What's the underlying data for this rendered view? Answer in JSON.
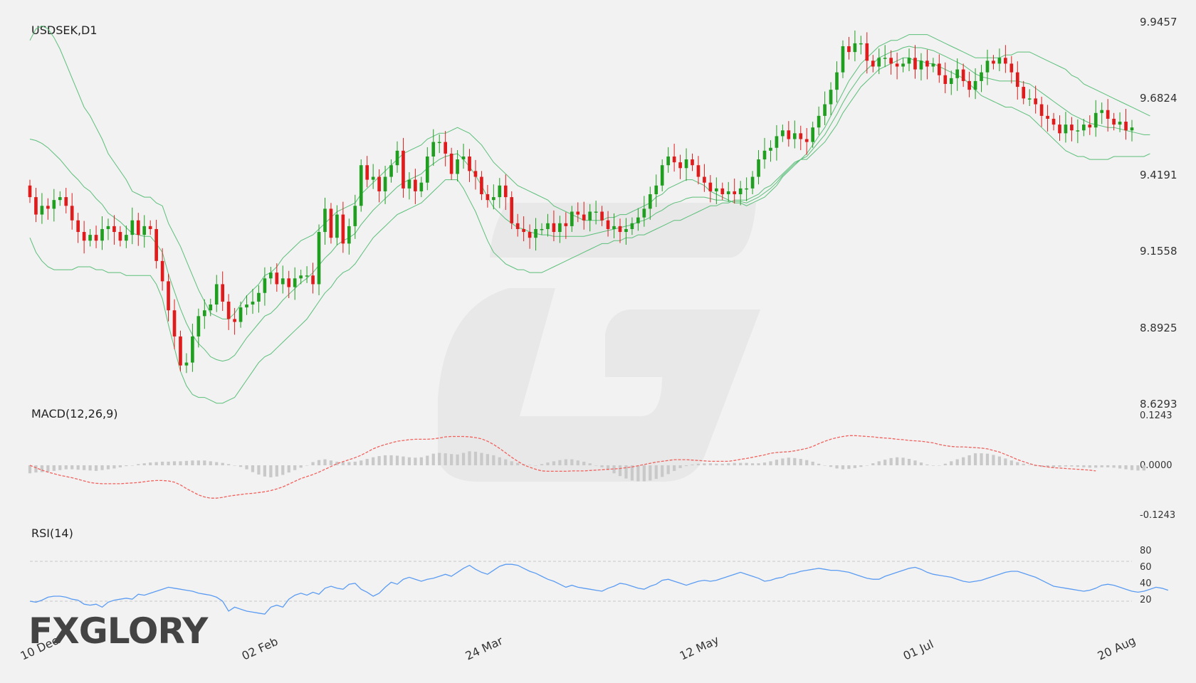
{
  "brand": {
    "logo_text": "FXGLORY",
    "accent": "#f07e26",
    "logo_color": "#444444"
  },
  "chart_data": [
    {
      "type": "candlestick",
      "title": "USDSEK,D1",
      "y_ticks": [
        "9.9457",
        "9.6824",
        "9.4191",
        "9.1558",
        "8.8925",
        "8.6293"
      ],
      "ylim": [
        8.6293,
        9.9457
      ],
      "x_labels": [
        "10 Dec",
        "02 Feb",
        "24 Mar",
        "12 May",
        "01 Jul",
        "20 Aug"
      ],
      "x_label_index": [
        0,
        38,
        79,
        117,
        157,
        195
      ],
      "up_color": "#1f9e1f",
      "down_color": "#e01b1b",
      "bands_color": "#5cbf7a",
      "close": [
        9.34,
        9.28,
        9.31,
        9.3,
        9.33,
        9.34,
        9.31,
        9.26,
        9.22,
        9.19,
        9.21,
        9.19,
        9.23,
        9.24,
        9.22,
        9.19,
        9.21,
        9.26,
        9.21,
        9.24,
        9.23,
        9.12,
        9.05,
        8.95,
        8.86,
        8.76,
        8.77,
        8.86,
        8.93,
        8.95,
        8.97,
        9.04,
        8.98,
        8.92,
        8.91,
        8.96,
        8.97,
        8.98,
        9.01,
        9.06,
        9.08,
        9.04,
        9.06,
        9.03,
        9.06,
        9.07,
        9.07,
        9.04,
        9.22,
        9.3,
        9.2,
        9.28,
        9.18,
        9.24,
        9.31,
        9.45,
        9.4,
        9.41,
        9.36,
        9.41,
        9.45,
        9.5,
        9.37,
        9.4,
        9.36,
        9.39,
        9.48,
        9.53,
        9.53,
        9.49,
        9.42,
        9.47,
        9.48,
        9.43,
        9.41,
        9.35,
        9.33,
        9.34,
        9.38,
        9.34,
        9.25,
        9.23,
        9.22,
        9.2,
        9.23,
        9.23,
        9.25,
        9.22,
        9.25,
        9.24,
        9.29,
        9.28,
        9.26,
        9.29,
        9.29,
        9.26,
        9.23,
        9.24,
        9.22,
        9.23,
        9.25,
        9.27,
        9.3,
        9.35,
        9.38,
        9.45,
        9.48,
        9.46,
        9.44,
        9.47,
        9.45,
        9.41,
        9.39,
        9.36,
        9.37,
        9.35,
        9.36,
        9.35,
        9.37,
        9.37,
        9.41,
        9.47,
        9.5,
        9.51,
        9.55,
        9.57,
        9.54,
        9.56,
        9.54,
        9.53,
        9.58,
        9.62,
        9.66,
        9.71,
        9.77,
        9.86,
        9.84,
        9.87,
        9.87,
        9.81,
        9.79,
        9.82,
        9.82,
        9.8,
        9.79,
        9.8,
        9.82,
        9.78,
        9.81,
        9.79,
        9.8,
        9.76,
        9.73,
        9.75,
        9.78,
        9.74,
        9.71,
        9.74,
        9.77,
        9.81,
        9.8,
        9.82,
        9.8,
        9.77,
        9.72,
        9.68,
        9.68,
        9.66,
        9.62,
        9.61,
        9.59,
        9.56,
        9.59,
        9.57,
        9.57,
        9.59,
        9.58,
        9.63,
        9.64,
        9.61,
        9.59,
        9.6,
        9.57,
        9.58
      ],
      "bb_upper": [
        9.88,
        9.92,
        9.93,
        9.92,
        9.89,
        9.85,
        9.8,
        9.75,
        9.7,
        9.65,
        9.62,
        9.58,
        9.54,
        9.49,
        9.46,
        9.43,
        9.4,
        9.36,
        9.35,
        9.34,
        9.34,
        9.32,
        9.31,
        9.25,
        9.21,
        9.17,
        9.12,
        9.07,
        9.02,
        8.98,
        8.94,
        8.93,
        8.92,
        8.92,
        8.94,
        8.97,
        9.0,
        9.02,
        9.04,
        9.07,
        9.08,
        9.1,
        9.13,
        9.15,
        9.17,
        9.19,
        9.2,
        9.21,
        9.23,
        9.25,
        9.27,
        9.29,
        9.3,
        9.31,
        9.32,
        9.35,
        9.37,
        9.39,
        9.41,
        9.43,
        9.45,
        9.47,
        9.49,
        9.5,
        9.51,
        9.52,
        9.54,
        9.55,
        9.56,
        9.56,
        9.57,
        9.58,
        9.57,
        9.56,
        9.54,
        9.52,
        9.49,
        9.46,
        9.44,
        9.42,
        9.4,
        9.38,
        9.37,
        9.36,
        9.35,
        9.34,
        9.33,
        9.31,
        9.3,
        9.29,
        9.28,
        9.27,
        9.26,
        9.26,
        9.26,
        9.26,
        9.27,
        9.27,
        9.28,
        9.28,
        9.29,
        9.3,
        9.31,
        9.32,
        9.34,
        9.35,
        9.37,
        9.38,
        9.39,
        9.4,
        9.4,
        9.39,
        9.38,
        9.36,
        9.35,
        9.34,
        9.33,
        9.32,
        9.32,
        9.31,
        9.32,
        9.33,
        9.34,
        9.36,
        9.38,
        9.41,
        9.43,
        9.45,
        9.47,
        9.49,
        9.52,
        9.55,
        9.58,
        9.62,
        9.66,
        9.7,
        9.74,
        9.77,
        9.8,
        9.82,
        9.84,
        9.86,
        9.87,
        9.88,
        9.88,
        9.89,
        9.9,
        9.9,
        9.9,
        9.9,
        9.89,
        9.88,
        9.87,
        9.86,
        9.85,
        9.84,
        9.83,
        9.82,
        9.82,
        9.82,
        9.82,
        9.82,
        9.83,
        9.83,
        9.84,
        9.84,
        9.84,
        9.83,
        9.82,
        9.81,
        9.8,
        9.79,
        9.78,
        9.76,
        9.75,
        9.73,
        9.72,
        9.71,
        9.7,
        9.69,
        9.68,
        9.67,
        9.66,
        9.65,
        9.64,
        9.63,
        9.62
      ],
      "bb_lower": [
        9.2,
        9.15,
        9.12,
        9.1,
        9.09,
        9.09,
        9.09,
        9.09,
        9.1,
        9.1,
        9.1,
        9.09,
        9.09,
        9.08,
        9.08,
        9.08,
        9.07,
        9.07,
        9.07,
        9.07,
        9.07,
        9.04,
        8.99,
        8.9,
        8.82,
        8.74,
        8.69,
        8.66,
        8.65,
        8.65,
        8.64,
        8.63,
        8.63,
        8.64,
        8.65,
        8.68,
        8.71,
        8.74,
        8.77,
        8.79,
        8.8,
        8.82,
        8.84,
        8.86,
        8.88,
        8.9,
        8.92,
        8.95,
        8.98,
        9.01,
        9.03,
        9.06,
        9.08,
        9.09,
        9.11,
        9.14,
        9.17,
        9.2,
        9.22,
        9.24,
        9.26,
        9.28,
        9.29,
        9.3,
        9.31,
        9.32,
        9.34,
        9.36,
        9.38,
        9.4,
        9.4,
        9.4,
        9.37,
        9.33,
        9.29,
        9.24,
        9.19,
        9.15,
        9.13,
        9.11,
        9.1,
        9.09,
        9.09,
        9.08,
        9.08,
        9.08,
        9.09,
        9.1,
        9.11,
        9.12,
        9.13,
        9.14,
        9.15,
        9.16,
        9.17,
        9.18,
        9.18,
        9.19,
        9.19,
        9.2,
        9.2,
        9.21,
        9.21,
        9.22,
        9.23,
        9.24,
        9.25,
        9.26,
        9.26,
        9.27,
        9.28,
        9.29,
        9.3,
        9.31,
        9.31,
        9.32,
        9.32,
        9.33,
        9.33,
        9.33,
        9.34,
        9.35,
        9.37,
        9.38,
        9.4,
        9.42,
        9.44,
        9.46,
        9.47,
        9.47,
        9.49,
        9.51,
        9.53,
        9.56,
        9.59,
        9.63,
        9.66,
        9.69,
        9.72,
        9.74,
        9.76,
        9.78,
        9.79,
        9.8,
        9.81,
        9.82,
        9.82,
        9.81,
        9.81,
        9.8,
        9.8,
        9.79,
        9.78,
        9.77,
        9.76,
        9.75,
        9.73,
        9.71,
        9.69,
        9.68,
        9.67,
        9.66,
        9.65,
        9.65,
        9.64,
        9.63,
        9.62,
        9.6,
        9.58,
        9.56,
        9.54,
        9.52,
        9.5,
        9.49,
        9.48,
        9.48,
        9.47,
        9.47,
        9.47,
        9.47,
        9.48,
        9.48,
        9.48,
        9.48,
        9.48,
        9.48,
        9.49
      ]
    },
    {
      "type": "macd",
      "title": "MACD(12,26,9)",
      "y_ticks": [
        "0.1243",
        "0.0000",
        "-0.1243"
      ],
      "ylim": [
        -0.1243,
        0.1243
      ],
      "signal_color": "#f0625d",
      "histogram_color": "#c9c9c9",
      "signal": [
        0.0,
        -0.006,
        -0.012,
        -0.017,
        -0.021,
        -0.025,
        -0.028,
        -0.031,
        -0.035,
        -0.039,
        -0.043,
        -0.045,
        -0.046,
        -0.046,
        -0.046,
        -0.046,
        -0.045,
        -0.044,
        -0.043,
        -0.041,
        -0.039,
        -0.038,
        -0.038,
        -0.039,
        -0.042,
        -0.049,
        -0.058,
        -0.066,
        -0.074,
        -0.079,
        -0.082,
        -0.082,
        -0.08,
        -0.077,
        -0.075,
        -0.073,
        -0.071,
        -0.07,
        -0.068,
        -0.066,
        -0.063,
        -0.059,
        -0.054,
        -0.047,
        -0.04,
        -0.033,
        -0.028,
        -0.023,
        -0.017,
        -0.01,
        -0.003,
        0.004,
        0.009,
        0.014,
        0.019,
        0.025,
        0.033,
        0.041,
        0.047,
        0.052,
        0.056,
        0.06,
        0.062,
        0.064,
        0.065,
        0.065,
        0.065,
        0.066,
        0.068,
        0.071,
        0.072,
        0.072,
        0.072,
        0.071,
        0.069,
        0.066,
        0.06,
        0.052,
        0.042,
        0.031,
        0.02,
        0.01,
        0.001,
        -0.005,
        -0.01,
        -0.014,
        -0.015,
        -0.015,
        -0.015,
        -0.015,
        -0.014,
        -0.014,
        -0.014,
        -0.013,
        -0.012,
        -0.011,
        -0.01,
        -0.009,
        -0.008,
        -0.006,
        -0.004,
        -0.001,
        0.002,
        0.005,
        0.008,
        0.01,
        0.012,
        0.014,
        0.014,
        0.014,
        0.013,
        0.012,
        0.011,
        0.01,
        0.01,
        0.01,
        0.01,
        0.012,
        0.015,
        0.017,
        0.02,
        0.023,
        0.026,
        0.03,
        0.032,
        0.033,
        0.034,
        0.036,
        0.039,
        0.042,
        0.047,
        0.054,
        0.06,
        0.065,
        0.069,
        0.072,
        0.074,
        0.074,
        0.073,
        0.072,
        0.071,
        0.069,
        0.068,
        0.067,
        0.065,
        0.064,
        0.062,
        0.061,
        0.06,
        0.058,
        0.056,
        0.052,
        0.049,
        0.047,
        0.046,
        0.046,
        0.045,
        0.044,
        0.043,
        0.041,
        0.037,
        0.033,
        0.027,
        0.021,
        0.014,
        0.009,
        0.004,
        0.0,
        -0.002,
        -0.004,
        -0.006,
        -0.007,
        -0.008,
        -0.009,
        -0.01,
        -0.011,
        -0.012,
        -0.014
      ],
      "histogram": [
        -0.02,
        -0.018,
        -0.017,
        -0.016,
        -0.014,
        -0.012,
        -0.01,
        -0.01,
        -0.011,
        -0.012,
        -0.013,
        -0.014,
        -0.012,
        -0.01,
        -0.008,
        -0.005,
        -0.002,
        0.0,
        0.003,
        0.005,
        0.007,
        0.008,
        0.009,
        0.009,
        0.01,
        0.01,
        0.011,
        0.012,
        0.012,
        0.012,
        0.01,
        0.008,
        0.006,
        0.003,
        0.0,
        -0.004,
        -0.01,
        -0.017,
        -0.023,
        -0.028,
        -0.03,
        -0.028,
        -0.024,
        -0.018,
        -0.012,
        -0.006,
        0.0,
        0.008,
        0.013,
        0.015,
        0.012,
        0.009,
        0.008,
        0.008,
        0.009,
        0.012,
        0.016,
        0.02,
        0.023,
        0.025,
        0.025,
        0.024,
        0.022,
        0.02,
        0.019,
        0.02,
        0.024,
        0.029,
        0.031,
        0.03,
        0.028,
        0.027,
        0.031,
        0.035,
        0.034,
        0.031,
        0.028,
        0.025,
        0.02,
        0.015,
        0.01,
        0.006,
        0.003,
        0.001,
        0.0,
        0.003,
        0.007,
        0.01,
        0.013,
        0.015,
        0.015,
        0.012,
        0.009,
        0.005,
        0.0,
        -0.005,
        -0.012,
        -0.02,
        -0.027,
        -0.033,
        -0.038,
        -0.04,
        -0.04,
        -0.038,
        -0.034,
        -0.029,
        -0.022,
        -0.014,
        -0.007,
        -0.002,
        0.002,
        0.004,
        0.005,
        0.005,
        0.004,
        0.004,
        0.005,
        0.006,
        0.006,
        0.006,
        0.005,
        0.005,
        0.007,
        0.01,
        0.014,
        0.017,
        0.019,
        0.018,
        0.016,
        0.013,
        0.009,
        0.004,
        0.0,
        -0.004,
        -0.008,
        -0.01,
        -0.009,
        -0.007,
        -0.004,
        0.0,
        0.005,
        0.01,
        0.014,
        0.018,
        0.02,
        0.019,
        0.016,
        0.012,
        0.007,
        0.002,
        -0.001,
        0.0,
        0.004,
        0.01,
        0.015,
        0.02,
        0.025,
        0.03,
        0.03,
        0.029,
        0.026,
        0.022,
        0.017,
        0.012,
        0.008,
        0.004,
        0.001,
        -0.002,
        -0.004,
        -0.005,
        -0.005,
        -0.004,
        -0.003,
        -0.003,
        -0.004,
        -0.005,
        -0.006,
        -0.006,
        -0.005,
        -0.005,
        -0.006,
        -0.008,
        -0.01,
        -0.012,
        -0.013,
        -0.013
      ]
    },
    {
      "type": "line",
      "title": "RSI(14)",
      "y_ticks": [
        "80",
        "60",
        "40",
        "20"
      ],
      "ylim": [
        0,
        100
      ],
      "levels": [
        70,
        30
      ],
      "line_color": "#5b9cf2",
      "values": [
        30,
        29,
        31,
        34,
        35,
        35,
        34,
        32,
        31,
        27,
        26,
        27,
        24,
        29,
        31,
        32,
        33,
        32,
        37,
        36,
        38,
        40,
        42,
        44,
        43,
        42,
        41,
        40,
        38,
        37,
        36,
        34,
        30,
        20,
        24,
        22,
        20,
        19,
        18,
        17,
        24,
        26,
        24,
        32,
        36,
        38,
        36,
        39,
        37,
        43,
        45,
        43,
        42,
        47,
        48,
        42,
        39,
        35,
        38,
        44,
        49,
        47,
        52,
        54,
        52,
        50,
        52,
        53,
        55,
        57,
        55,
        59,
        63,
        66,
        62,
        59,
        57,
        61,
        65,
        67,
        67,
        66,
        63,
        60,
        58,
        55,
        52,
        50,
        47,
        44,
        46,
        44,
        43,
        42,
        41,
        40,
        43,
        45,
        48,
        47,
        45,
        43,
        42,
        45,
        47,
        51,
        52,
        50,
        48,
        46,
        48,
        50,
        51,
        50,
        51,
        53,
        55,
        57,
        59,
        57,
        55,
        53,
        50,
        51,
        53,
        54,
        57,
        58,
        60,
        61,
        62,
        63,
        62,
        61,
        61,
        60,
        59,
        57,
        55,
        53,
        52,
        52,
        55,
        57,
        59,
        61,
        63,
        64,
        62,
        59,
        57,
        56,
        55,
        54,
        52,
        50,
        49,
        50,
        51,
        53,
        55,
        57,
        59,
        60,
        60,
        58,
        56,
        54,
        51,
        48,
        45,
        44,
        43,
        42,
        41,
        40,
        41,
        43,
        46,
        47,
        46,
        44,
        42,
        40,
        39,
        40,
        42,
        44,
        43,
        41
      ]
    }
  ]
}
